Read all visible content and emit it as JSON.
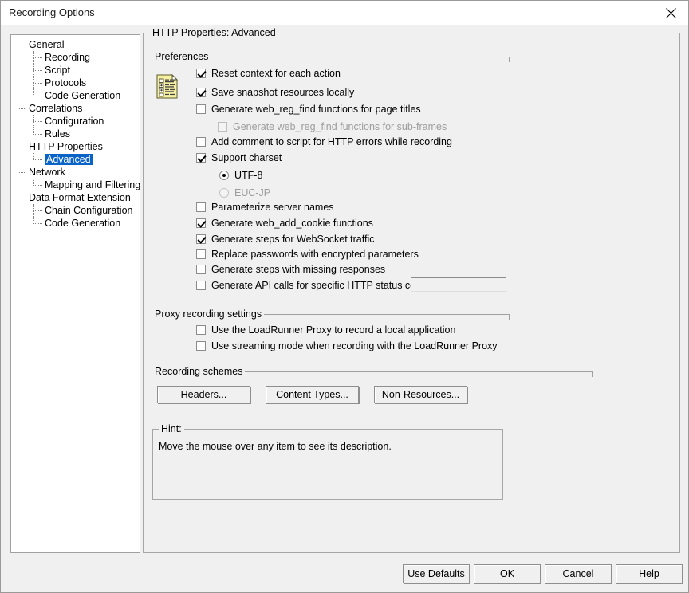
{
  "window": {
    "title": "Recording Options",
    "close_icon": "close-icon"
  },
  "tree": {
    "items": [
      {
        "label": "General",
        "level": 0,
        "selected": false,
        "last": false
      },
      {
        "label": "Recording",
        "level": 1,
        "selected": false,
        "last": false
      },
      {
        "label": "Script",
        "level": 1,
        "selected": false,
        "last": false
      },
      {
        "label": "Protocols",
        "level": 1,
        "selected": false,
        "last": false
      },
      {
        "label": "Code Generation",
        "level": 1,
        "selected": false,
        "last": true
      },
      {
        "label": "Correlations",
        "level": 0,
        "selected": false,
        "last": false
      },
      {
        "label": "Configuration",
        "level": 1,
        "selected": false,
        "last": false
      },
      {
        "label": "Rules",
        "level": 1,
        "selected": false,
        "last": true
      },
      {
        "label": "HTTP Properties",
        "level": 0,
        "selected": false,
        "last": false
      },
      {
        "label": "Advanced",
        "level": 1,
        "selected": true,
        "last": true
      },
      {
        "label": "Network",
        "level": 0,
        "selected": false,
        "last": false
      },
      {
        "label": "Mapping and Filtering",
        "level": 1,
        "selected": false,
        "last": true
      },
      {
        "label": "Data Format Extension",
        "level": 0,
        "selected": false,
        "last": true
      },
      {
        "label": "Chain Configuration",
        "level": 1,
        "selected": false,
        "last": false
      },
      {
        "label": "Code Generation",
        "level": 1,
        "selected": false,
        "last": true
      }
    ]
  },
  "main": {
    "title": "HTTP Properties: Advanced",
    "preferences": {
      "caption": "Preferences",
      "icon": "preferences-list-icon",
      "options": [
        {
          "label": "Reset context for each action",
          "checked": true,
          "disabled": false,
          "indent": 0
        },
        {
          "label": "Save snapshot resources locally",
          "checked": true,
          "disabled": false,
          "indent": 0
        },
        {
          "label": "Generate web_reg_find functions for page titles",
          "checked": false,
          "disabled": false,
          "indent": 0
        },
        {
          "label": "Generate web_reg_find functions for sub-frames",
          "checked": false,
          "disabled": true,
          "indent": 1
        },
        {
          "label": "Add comment to script for HTTP errors while recording",
          "checked": false,
          "disabled": false,
          "indent": 0
        },
        {
          "label": "Support charset",
          "checked": true,
          "disabled": false,
          "indent": 0
        }
      ],
      "charset_radios": [
        {
          "label": "UTF-8",
          "selected": true,
          "disabled": false
        },
        {
          "label": "EUC-JP",
          "selected": false,
          "disabled": true
        }
      ],
      "options2": [
        {
          "label": "Parameterize server names",
          "checked": false,
          "disabled": false
        },
        {
          "label": "Generate web_add_cookie functions",
          "checked": true,
          "disabled": false
        },
        {
          "label": "Generate steps for WebSocket traffic",
          "checked": true,
          "disabled": false
        },
        {
          "label": "Replace passwords with encrypted parameters",
          "checked": false,
          "disabled": false
        },
        {
          "label": "Generate steps with missing responses",
          "checked": false,
          "disabled": false
        },
        {
          "label": "Generate API calls for specific HTTP status codes:",
          "checked": false,
          "disabled": false
        }
      ],
      "status_codes_field": {
        "value": "",
        "placeholder": ""
      }
    },
    "proxy": {
      "caption": "Proxy recording settings",
      "options": [
        {
          "label": "Use the LoadRunner Proxy to record a local application",
          "checked": false
        },
        {
          "label": "Use streaming mode when recording with the LoadRunner Proxy",
          "checked": false
        }
      ]
    },
    "schemes": {
      "caption": "Recording schemes",
      "buttons": [
        {
          "label": "Headers..."
        },
        {
          "label": "Content Types..."
        },
        {
          "label": "Non-Resources..."
        }
      ]
    },
    "hint": {
      "caption": "Hint:",
      "text": "Move the mouse over any item to see its description."
    }
  },
  "footer": {
    "buttons": [
      {
        "label": "Use Defaults"
      },
      {
        "label": "OK"
      },
      {
        "label": "Cancel"
      },
      {
        "label": "Help"
      }
    ]
  },
  "colors": {
    "selection": "#0a64c8",
    "dialog_bg": "#f0f0f0",
    "icon_yellow": "#f5f0a0"
  }
}
